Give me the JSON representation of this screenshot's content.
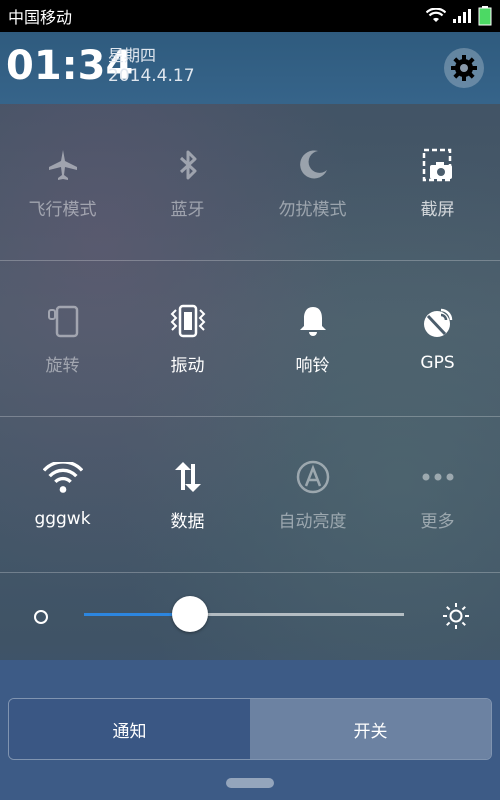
{
  "status_bar": {
    "carrier": "中国移动",
    "wifi_icon": "wifi-icon",
    "signal_icon": "signal-icon",
    "battery_icon": "battery-icon"
  },
  "header": {
    "time": "01:34",
    "weekday": "星期四",
    "date": "2014.4.17",
    "settings_icon": "gear-icon"
  },
  "toggles": [
    [
      {
        "label": "飞行模式",
        "icon": "airplane-icon",
        "active": false
      },
      {
        "label": "蓝牙",
        "icon": "bluetooth-icon",
        "active": false
      },
      {
        "label": "勿扰模式",
        "icon": "moon-icon",
        "active": false
      },
      {
        "label": "截屏",
        "icon": "screenshot-icon",
        "active": false
      }
    ],
    [
      {
        "label": "旋转",
        "icon": "rotate-icon",
        "active": false
      },
      {
        "label": "振动",
        "icon": "vibrate-icon",
        "active": true
      },
      {
        "label": "响铃",
        "icon": "bell-icon",
        "active": true
      },
      {
        "label": "GPS",
        "icon": "gps-icon",
        "active": true
      }
    ],
    [
      {
        "label": "gggwk",
        "icon": "wifi-icon",
        "active": true
      },
      {
        "label": "数据",
        "icon": "data-icon",
        "active": true
      },
      {
        "label": "自动亮度",
        "icon": "auto-brightness-icon",
        "active": false
      },
      {
        "label": "更多",
        "icon": "more-icon",
        "active": false
      }
    ]
  ],
  "brightness": {
    "level": 0.33,
    "low_icon": "brightness-low-icon",
    "high_icon": "brightness-high-icon"
  },
  "tabs": {
    "notifications": "通知",
    "toggles": "开关"
  },
  "colors": {
    "slider_fill": "#2c86e0",
    "header_bg": "#2f5b7e"
  }
}
